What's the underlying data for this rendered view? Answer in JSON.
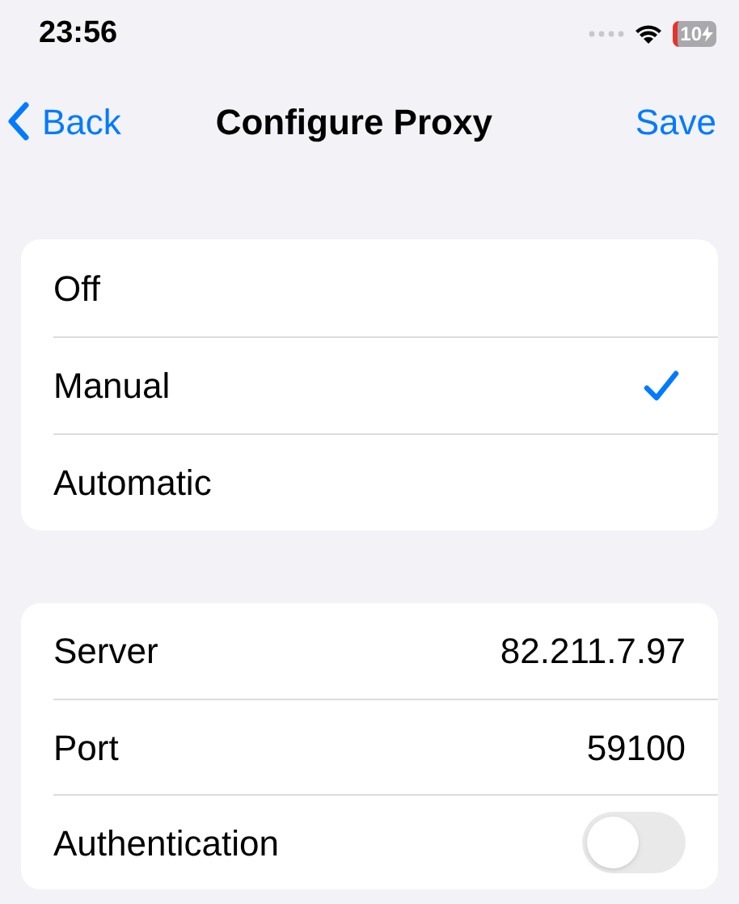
{
  "status_bar": {
    "time": "23:56",
    "battery": "10",
    "charging": true
  },
  "nav": {
    "back": "Back",
    "title": "Configure Proxy",
    "action": "Save"
  },
  "modes": [
    {
      "label": "Off",
      "selected": false
    },
    {
      "label": "Manual",
      "selected": true
    },
    {
      "label": "Automatic",
      "selected": false
    }
  ],
  "settings": [
    {
      "kind": "value",
      "label": "Server",
      "value": "82.211.7.97"
    },
    {
      "kind": "value",
      "label": "Port",
      "value": "59100"
    },
    {
      "kind": "toggle",
      "label": "Authentication",
      "on": false
    }
  ]
}
